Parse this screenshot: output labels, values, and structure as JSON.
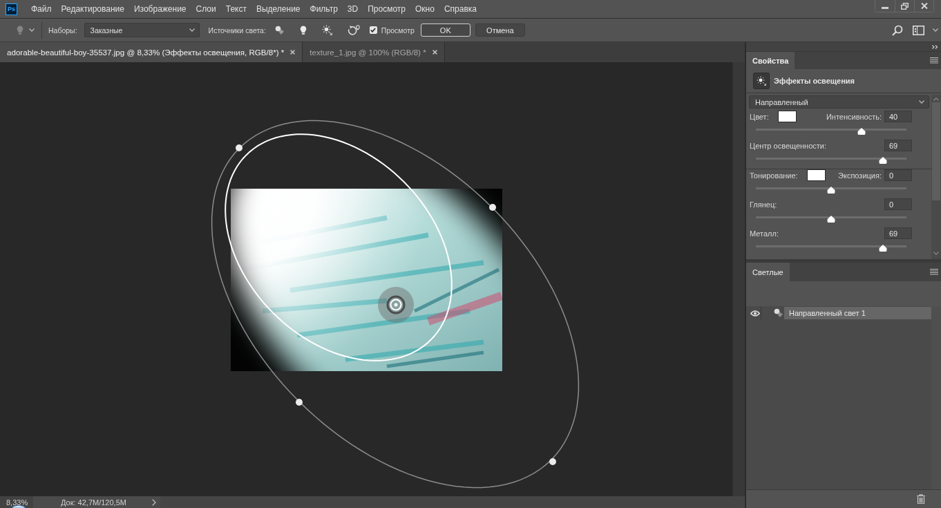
{
  "app": {
    "logo": "Ps"
  },
  "menu": [
    "Файл",
    "Редактирование",
    "Изображение",
    "Слои",
    "Текст",
    "Выделение",
    "Фильтр",
    "3D",
    "Просмотр",
    "Окно",
    "Справка"
  ],
  "options_bar": {
    "presets_label": "Наборы:",
    "presets": {
      "value": "Заказные"
    },
    "lights_label": "Источники света:",
    "preview": {
      "label": "Просмотр",
      "checked": true
    },
    "buttons": [
      {
        "label": "OK",
        "kind": "default"
      },
      {
        "label": "Отмена",
        "kind": "normal"
      }
    ]
  },
  "tabs": [
    {
      "label": "adorable-beautiful-boy-35537.jpg @ 8,33% (Эффекты освещения, RGB/8*) *",
      "selected": true
    },
    {
      "label": "texture_1.jpg @ 100% (RGB/8) *",
      "selected": false
    }
  ],
  "properties": {
    "tab": "Свойства",
    "title": "Эффекты освещения",
    "light_type": "Направленный",
    "sections": [
      {
        "rows": [
          {
            "kind": "color",
            "label": "Цвет:",
            "color": "#ffffff",
            "value_label": "Интенсивность:",
            "value": "40",
            "level": 0.7
          },
          {
            "kind": "plain",
            "label": "Центр освещенности:",
            "value": "69",
            "level": 0.845
          }
        ]
      },
      {
        "rows": [
          {
            "kind": "color",
            "label": "Тонирование:",
            "color": "#ffffff",
            "value_label": "Экспозиция:",
            "value": "0",
            "level": 0.5
          },
          {
            "kind": "plain",
            "label": "Глянец:",
            "value": "0",
            "level": 0.5
          },
          {
            "kind": "plain",
            "label": "Металл:",
            "value": "69",
            "level": 0.845
          }
        ]
      }
    ]
  },
  "lights": {
    "tab": "Светлые",
    "items": [
      {
        "label": "Направленный свет 1",
        "visible": true,
        "selected": true
      }
    ]
  },
  "status_bar": {
    "zoom": "8,33%",
    "doc": "Док: 42,7M/120,5M"
  }
}
